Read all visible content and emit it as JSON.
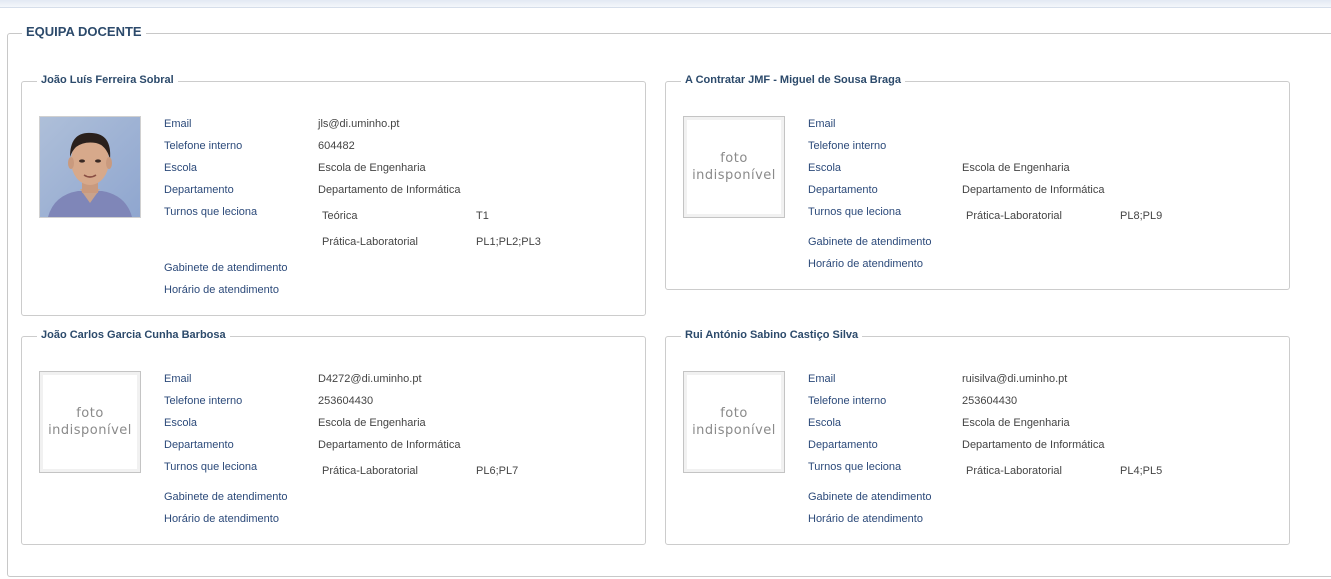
{
  "section_title": "EQUIPA DOCENTE",
  "labels": {
    "email": "Email",
    "telefone": "Telefone interno",
    "escola": "Escola",
    "departamento": "Departamento",
    "turnos": "Turnos que leciona",
    "gabinete": "Gabinete de atendimento",
    "horario": "Horário de atendimento"
  },
  "photo_placeholder": {
    "line1": "foto",
    "line2": "indisponível"
  },
  "teachers": [
    {
      "name": "João Luís Ferreira Sobral",
      "photo": "person-photo",
      "email": "jls@di.uminho.pt",
      "telefone": "604482",
      "escola": "Escola de Engenharia",
      "departamento": "Departamento de Informática",
      "turnos": [
        {
          "tipo": "Teórica",
          "turnos": "T1"
        },
        {
          "tipo": "Prática-Laboratorial",
          "turnos": "PL1;PL2;PL3"
        }
      ]
    },
    {
      "name": "A Contratar JMF - Miguel de Sousa Braga",
      "photo": "unavailable",
      "email": "",
      "telefone": "",
      "escola": "Escola de Engenharia",
      "departamento": "Departamento de Informática",
      "turnos": [
        {
          "tipo": "Prática-Laboratorial",
          "turnos": "PL8;PL9"
        }
      ]
    },
    {
      "name": "João Carlos Garcia Cunha Barbosa",
      "photo": "unavailable",
      "email": "D4272@di.uminho.pt",
      "telefone": "253604430",
      "escola": "Escola de Engenharia",
      "departamento": "Departamento de Informática",
      "turnos": [
        {
          "tipo": "Prática-Laboratorial",
          "turnos": "PL6;PL7"
        }
      ]
    },
    {
      "name": "Rui António Sabino Castiço Silva",
      "photo": "unavailable",
      "email": "ruisilva@di.uminho.pt",
      "telefone": "253604430",
      "escola": "Escola de Engenharia",
      "departamento": "Departamento de Informática",
      "turnos": [
        {
          "tipo": "Prática-Laboratorial",
          "turnos": "PL4;PL5"
        }
      ]
    }
  ]
}
